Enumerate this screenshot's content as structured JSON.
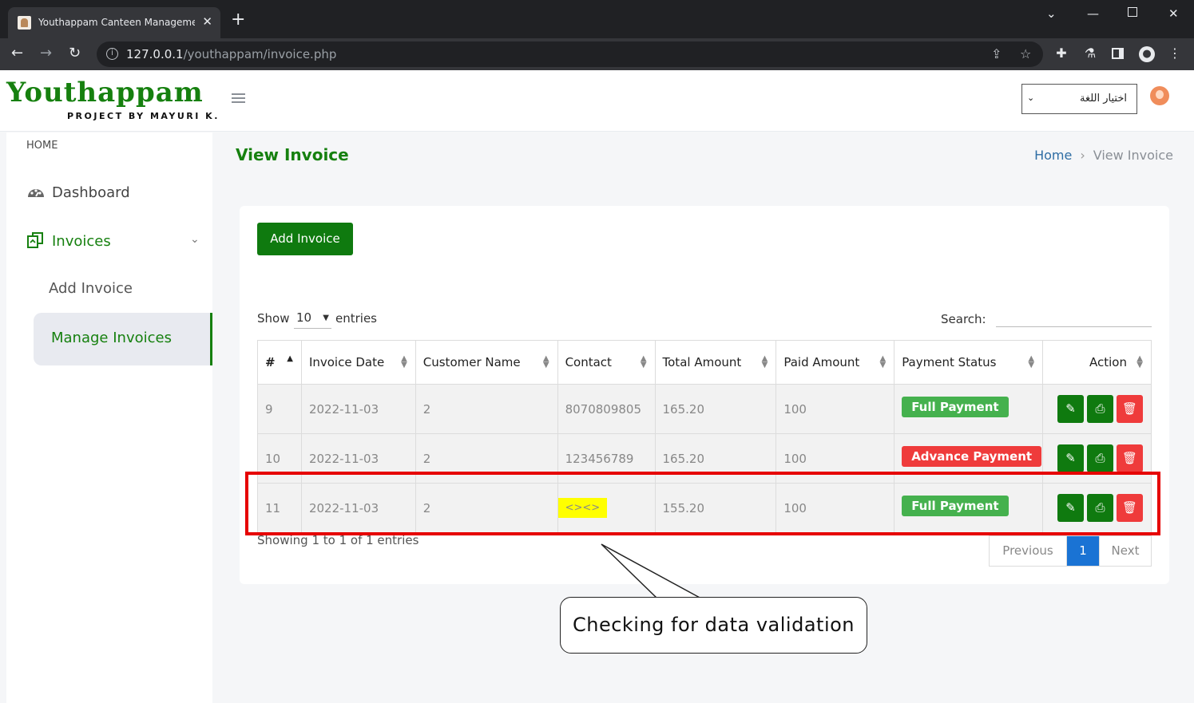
{
  "browser": {
    "tab_title": "Youthappam Canteen Management",
    "url_host": "127.0.0.1",
    "url_path": "/youthappam/invoice.php"
  },
  "header": {
    "logo": "Youthappam",
    "logo_sub": "PROJECT BY MAYURI K.",
    "language_select": "اختيار اللغة"
  },
  "sidebar": {
    "section": "HOME",
    "items": [
      {
        "label": "Dashboard"
      },
      {
        "label": "Invoices"
      },
      {
        "label": "Add Invoice"
      },
      {
        "label": "Manage Invoices"
      }
    ]
  },
  "main": {
    "title": "View Invoice",
    "breadcrumb": {
      "home": "Home",
      "current": "View Invoice"
    },
    "add_button": "Add Invoice",
    "show_label": "Show",
    "show_value": "10",
    "entries_label": "entries",
    "search_label": "Search:",
    "showing_text": "Showing 1 to 1 of 1 entries",
    "pagination": {
      "previous": "Previous",
      "page": "1",
      "next": "Next"
    }
  },
  "table": {
    "headers": [
      "#",
      "Invoice Date",
      "Customer Name",
      "Contact",
      "Total Amount",
      "Paid Amount",
      "Payment Status",
      "Action"
    ],
    "rows": [
      {
        "id": "9",
        "date": "2022-11-03",
        "customer": "2",
        "contact": "8070809805",
        "total": "165.20",
        "paid": "100",
        "status": "Full Payment"
      },
      {
        "id": "10",
        "date": "2022-11-03",
        "customer": "2",
        "contact": "123456789",
        "total": "165.20",
        "paid": "100",
        "status": "Advance Payment"
      },
      {
        "id": "11",
        "date": "2022-11-03",
        "customer": "2",
        "contact": "<><>",
        "total": "155.20",
        "paid": "100",
        "status": "Full Payment"
      }
    ]
  },
  "annotation": {
    "text": "Checking for data validation"
  },
  "colors": {
    "brand_green": "#16800f",
    "button_green": "#0f7a0f",
    "danger": "#ef3b3b",
    "success_badge": "#45b14e",
    "highlight": "#ffff00",
    "annotation_red": "#e60000"
  }
}
